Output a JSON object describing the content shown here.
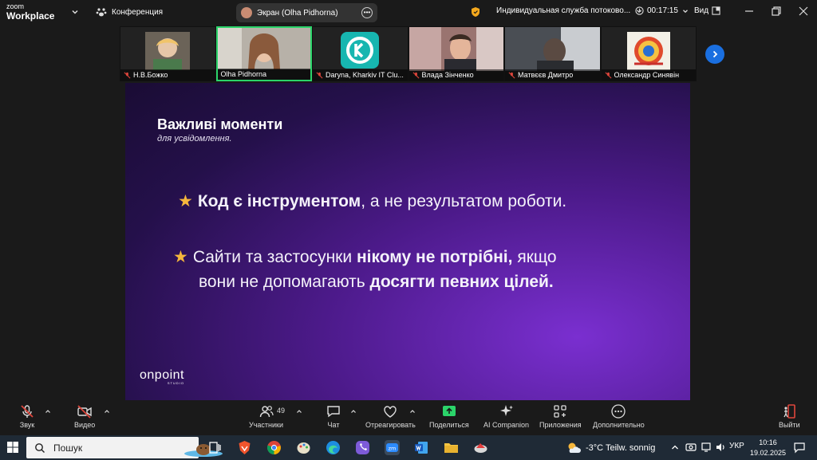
{
  "app": {
    "brand_line1": "zoom",
    "brand_line2": "Workplace",
    "meeting_label": "Конференция",
    "screen_share_label": "Экран (Olha Pidhorna)",
    "service_label": "Индивидуальная служба потоково...",
    "timer": "00:17:15",
    "view_label": "Вид"
  },
  "participants": [
    {
      "name": "Н.В.Божко",
      "muted": true,
      "active": false
    },
    {
      "name": "Olha Pidhorna",
      "muted": false,
      "active": true
    },
    {
      "name": "Daryna, Kharkiv IT Clu...",
      "muted": true,
      "active": false
    },
    {
      "name": "Влада Зінченко",
      "muted": true,
      "active": false
    },
    {
      "name": "Матвєєв Дмитро",
      "muted": true,
      "active": false
    },
    {
      "name": "Олександр Синявін",
      "muted": true,
      "active": false
    }
  ],
  "slide": {
    "title": "Важливі моменти",
    "subtitle": "для усвідомлення.",
    "point1_bold": "Код є інструментом",
    "point1_rest": ", а не результатом роботи.",
    "point2_start": "Сайти та застосунки ",
    "point2_bold": "нікому не потрібні,",
    "point2_end": " якщо",
    "point3_start": "вони не допомагають ",
    "point3_bold": "досягти певних цілей.",
    "logo": "onpoint",
    "logo_sub": "STUDIO"
  },
  "toolbar": {
    "audio": "Звук",
    "video": "Видео",
    "participants": "Участники",
    "participants_count": "49",
    "chat": "Чат",
    "react": "Отреагировать",
    "share": "Поделиться",
    "ai": "AI Companion",
    "apps": "Приложения",
    "more": "Дополнительно",
    "leave": "Выйти"
  },
  "taskbar": {
    "search_placeholder": "Пошук",
    "weather": "-3°C  Teilw. sonnig",
    "lang": "УКР",
    "time": "10:16",
    "date": "19.02.2025"
  },
  "colors": {
    "accent_green": "#2bd46a",
    "accent_blue": "#1a6fe0",
    "star": "#f6b73c",
    "mute_red": "#e0463c"
  }
}
